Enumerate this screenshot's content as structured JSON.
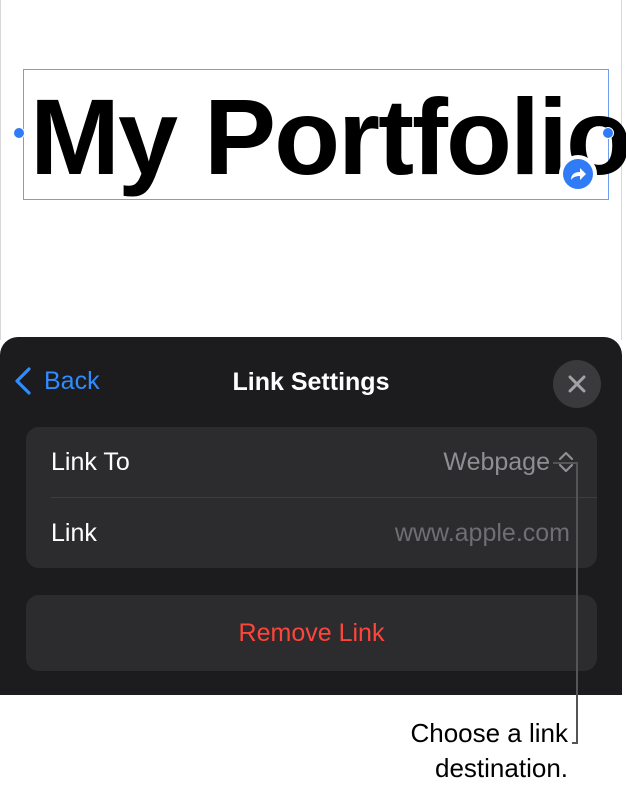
{
  "document": {
    "textbox_text": "My Portfolio"
  },
  "sheet": {
    "back_label": "Back",
    "title": "Link Settings",
    "close_icon": "close-icon",
    "rows": [
      {
        "label": "Link To",
        "value": "Webpage"
      },
      {
        "label": "Link",
        "placeholder": "www.apple.com"
      }
    ],
    "remove_label": "Remove Link"
  },
  "callout": {
    "line1": "Choose a link",
    "line2": "destination."
  },
  "colors": {
    "accent": "#2f8cff",
    "destructive": "#ff453a",
    "sheet_bg": "#1c1c1e",
    "group_bg": "#2c2c2e",
    "selection": "#6e9ef0"
  }
}
